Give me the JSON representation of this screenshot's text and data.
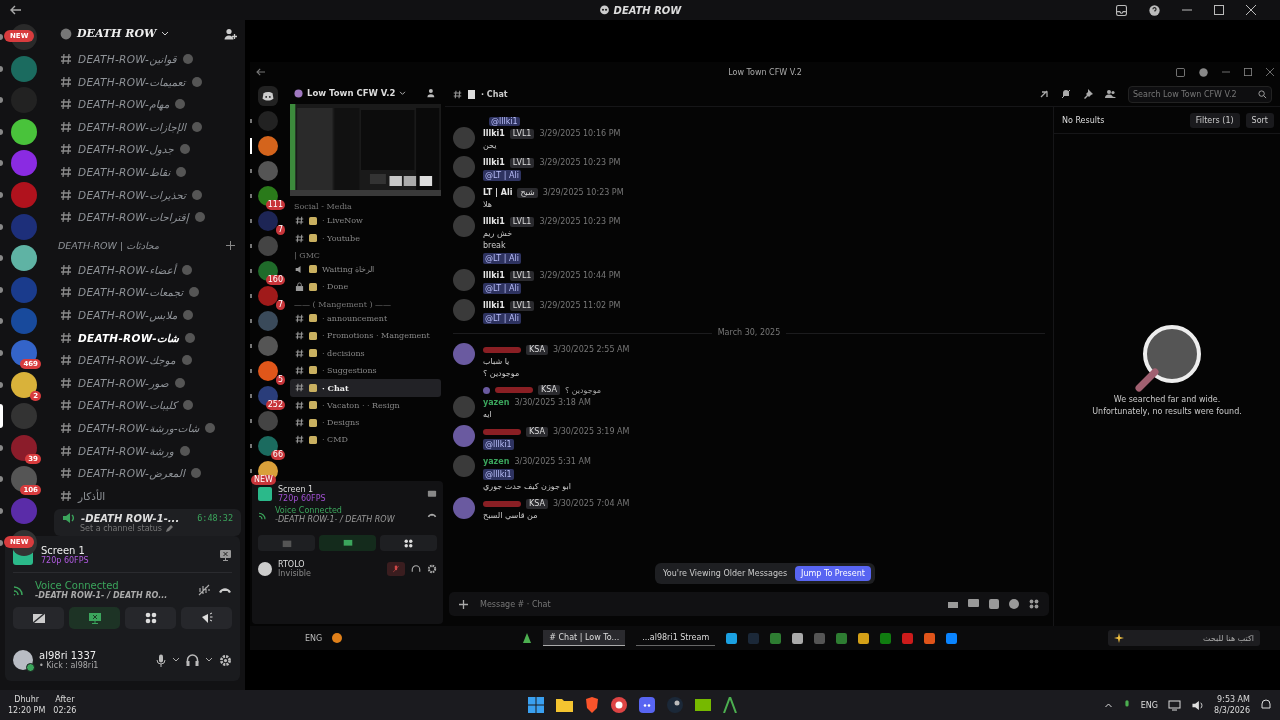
{
  "window": {
    "title": "DEATH ROW"
  },
  "servers": [
    {
      "selected": false,
      "badge": "NEW"
    },
    {
      "selected": false
    },
    {
      "selected": false
    },
    {
      "selected": false
    },
    {
      "selected": false
    },
    {
      "selected": false
    },
    {
      "selected": false
    },
    {
      "selected": false
    },
    {
      "selected": false
    },
    {
      "selected": false
    },
    {
      "selected": false,
      "badge": "469"
    },
    {
      "selected": false,
      "badge": "2"
    },
    {
      "selected": true
    },
    {
      "selected": false,
      "badge": "39"
    },
    {
      "selected": false,
      "badge": "106"
    },
    {
      "selected": false
    },
    {
      "selected": false,
      "badge": "NEW"
    }
  ],
  "server_name": "DEATH ROW",
  "channels": [
    {
      "kind": "text",
      "name": "DEATH-ROW-قوانين",
      "selected": false
    },
    {
      "kind": "text",
      "name": "DEATH-ROW-تعميمات",
      "selected": false
    },
    {
      "kind": "text",
      "name": "DEATH-ROW-مهام",
      "selected": false
    },
    {
      "kind": "text",
      "name": "DEATH-ROW-الإجازات",
      "selected": false
    },
    {
      "kind": "text",
      "name": "DEATH-ROW-جدول",
      "selected": false
    },
    {
      "kind": "text",
      "name": "DEATH-ROW-نقاط",
      "selected": false
    },
    {
      "kind": "text",
      "name": "DEATH-ROW-تحذيرات",
      "selected": false
    },
    {
      "kind": "text",
      "name": "DEATH-ROW-إقتراحات",
      "selected": false
    },
    {
      "kind": "category",
      "name": "DEATH-ROW | محادثات"
    },
    {
      "kind": "text",
      "name": "DEATH-ROW-أعضاء",
      "selected": false
    },
    {
      "kind": "text",
      "name": "DEATH-ROW-تجمعات",
      "selected": false
    },
    {
      "kind": "text",
      "name": "DEATH-ROW-ملابس",
      "selected": false
    },
    {
      "kind": "text",
      "name": "DEATH-ROW-شات",
      "selected": true
    },
    {
      "kind": "text",
      "name": "DEATH-ROW-موجك",
      "selected": false
    },
    {
      "kind": "text",
      "name": "DEATH-ROW-صور",
      "selected": false
    },
    {
      "kind": "text",
      "name": "DEATH-ROW-كليبات",
      "selected": false
    },
    {
      "kind": "text",
      "name": "DEATH-ROW-شات-ورشة",
      "selected": false
    },
    {
      "kind": "text",
      "name": "DEATH-ROW-ورشة",
      "selected": false
    },
    {
      "kind": "text",
      "name": "DEATH-ROW-المعرض",
      "selected": false
    },
    {
      "kind": "plain",
      "name": "الأذكار",
      "selected": false
    }
  ],
  "voice_channel": {
    "name": "-DEATH ROW-1-...",
    "timer": "6:48:32",
    "status_placeholder": "Set a channel status"
  },
  "stream_panel": {
    "title": "Screen 1",
    "quality": "720p 60FPS"
  },
  "voice": {
    "status": "Voice Connected",
    "channel": "-DEATH ROW-1- / DEATH RO..."
  },
  "user": {
    "name": "al98ri 1337",
    "activity": "• Kick : al98ri1"
  },
  "prayer": [
    {
      "label": "Dhuhr",
      "time": "12:20 PM"
    },
    {
      "label": "After",
      "time": "02:26"
    }
  ],
  "inner": {
    "title": "Low Town CFW V.2",
    "servers": [
      {
        "selected": false
      },
      {
        "selected": true
      },
      {
        "selected": false
      },
      {
        "selected": false,
        "badge": "111"
      },
      {
        "selected": false,
        "badge": "7"
      },
      {
        "selected": false
      },
      {
        "selected": false,
        "badge": "160"
      },
      {
        "selected": false,
        "badge": "7"
      },
      {
        "selected": false
      },
      {
        "selected": false
      },
      {
        "selected": false,
        "badge": "5"
      },
      {
        "selected": false,
        "badge": "252"
      },
      {
        "selected": false
      },
      {
        "selected": false,
        "badge": "66"
      },
      {
        "selected": false,
        "badge": "NEW"
      }
    ],
    "server_name": "Low Town CFW V.2",
    "channels": [
      {
        "kind": "category",
        "name": "Social - Media"
      },
      {
        "kind": "text",
        "name": "· LiveNow",
        "selected": false
      },
      {
        "kind": "text",
        "name": "· Youtube",
        "selected": false
      },
      {
        "kind": "category",
        "name": "| GMC"
      },
      {
        "kind": "voice",
        "name": "Waiting الرخاة",
        "selected": false
      },
      {
        "kind": "locked",
        "name": "· Done",
        "selected": false
      },
      {
        "kind": "category",
        "name": "—— ( Mangement ) ——"
      },
      {
        "kind": "text",
        "name": "· announcement",
        "selected": false
      },
      {
        "kind": "text",
        "name": "· Promotions · Mangement",
        "selected": false
      },
      {
        "kind": "text",
        "name": "· decisions",
        "selected": false
      },
      {
        "kind": "text",
        "name": "· Suggestions",
        "selected": false
      },
      {
        "kind": "text",
        "name": "· Chat",
        "selected": true
      },
      {
        "kind": "text",
        "name": "· Vacaton · · Resign",
        "selected": false
      },
      {
        "kind": "text",
        "name": "· Designs",
        "selected": false
      },
      {
        "kind": "text",
        "name": "· CMD",
        "selected": false
      }
    ],
    "stream_panel": {
      "title": "Screen 1",
      "quality": "720p 60FPS"
    },
    "voice": {
      "status": "Voice Connected",
      "channel": "-DEATH ROW-1- / DEATH ROW"
    },
    "user": {
      "name": "RTOLO",
      "status": "Invisible"
    },
    "chat_title": "· Chat",
    "search": {
      "placeholder": "Search Low Town CFW V.2"
    },
    "messages": [
      {
        "kind": "mention",
        "text": "@lllki1"
      },
      {
        "kind": "message",
        "author": "lllki1",
        "color": "#e8e8e8",
        "tag": "LVL1",
        "time": "3/29/2025 10:16 PM",
        "lines": [
          {
            "kind": "text",
            "text": "يحن"
          }
        ]
      },
      {
        "kind": "message",
        "author": "lllki1",
        "color": "#e8e8e8",
        "tag": "LVL1",
        "time": "3/29/2025 10:23 PM",
        "lines": [
          {
            "kind": "mention",
            "text": "@LT | Ali"
          }
        ]
      },
      {
        "kind": "message",
        "author": "LT | Ali",
        "color": "#e8e8e8",
        "tag": "شبح",
        "time": "3/29/2025 10:23 PM",
        "lines": [
          {
            "kind": "text",
            "text": "هلا"
          }
        ]
      },
      {
        "kind": "message",
        "author": "lllki1",
        "color": "#e8e8e8",
        "tag": "LVL1",
        "time": "3/29/2025 10:23 PM",
        "lines": [
          {
            "kind": "text",
            "text": "خش ريم"
          },
          {
            "kind": "text",
            "text": "break"
          },
          {
            "kind": "mention",
            "text": "@LT | Ali"
          }
        ]
      },
      {
        "kind": "message",
        "author": "lllki1",
        "color": "#e8e8e8",
        "tag": "LVL1",
        "time": "3/29/2025 10:44 PM",
        "lines": [
          {
            "kind": "mention",
            "text": "@LT | Ali"
          }
        ]
      },
      {
        "kind": "message",
        "author": "lllki1",
        "color": "#e8e8e8",
        "tag": "LVL1",
        "time": "3/29/2025 11:02 PM",
        "lines": [
          {
            "kind": "mention",
            "text": "@LT | Ali"
          }
        ]
      },
      {
        "kind": "divider",
        "text": "March 30, 2025"
      },
      {
        "kind": "message",
        "color": "#8a1f24",
        "tag": "KSA",
        "time": "3/30/2025 2:55 AM",
        "lines": [
          {
            "kind": "text",
            "text": "يا شباب"
          },
          {
            "kind": "text",
            "text": "موجودين ؟"
          }
        ]
      },
      {
        "kind": "message",
        "author": "yazen",
        "color": "#3ba55c",
        "reply": "موجودين ؟",
        "reply_tag": "KSA",
        "time": "3/30/2025 3:18 AM",
        "lines": [
          {
            "kind": "text",
            "text": "ايه"
          }
        ]
      },
      {
        "kind": "message",
        "color": "#8a1f24",
        "tag": "KSA",
        "time": "3/30/2025 3:19 AM",
        "lines": [
          {
            "kind": "mention",
            "text": "@lllki1"
          }
        ]
      },
      {
        "kind": "message",
        "author": "yazen",
        "color": "#3ba55c",
        "time": "3/30/2025 5:31 AM",
        "lines": [
          {
            "kind": "mention",
            "text": "@lllki1"
          },
          {
            "kind": "text",
            "text": "ابو جوزن كيف حدث جوري"
          }
        ]
      },
      {
        "kind": "message",
        "color": "#8a1f24",
        "tag": "KSA",
        "time": "3/30/2025 7:04 AM",
        "lines": [
          {
            "kind": "text",
            "text": "من قاسي السبح"
          }
        ]
      }
    ],
    "toast": {
      "text": "You're Viewing Older Messages",
      "button": "Jump To Present"
    },
    "composer": {
      "placeholder": "Message # · Chat"
    },
    "results": {
      "title": "No Results",
      "filters": "Filters (1)",
      "sort": "Sort",
      "empty_line_1": "We searched far and wide.",
      "empty_line_2": "Unfortunately, no results were found."
    },
    "taskbar": {
      "language": "ENG",
      "tasks": [
        {
          "label": "# Chat | Low To...",
          "selected": true
        },
        {
          "label": "...al98ri1 Stream",
          "selected": false
        }
      ],
      "search_placeholder": "اكتب هنا للبحث"
    }
  },
  "taskbar": {
    "language": "ENG",
    "time": "9:53 AM",
    "date": "8/3/2026"
  }
}
